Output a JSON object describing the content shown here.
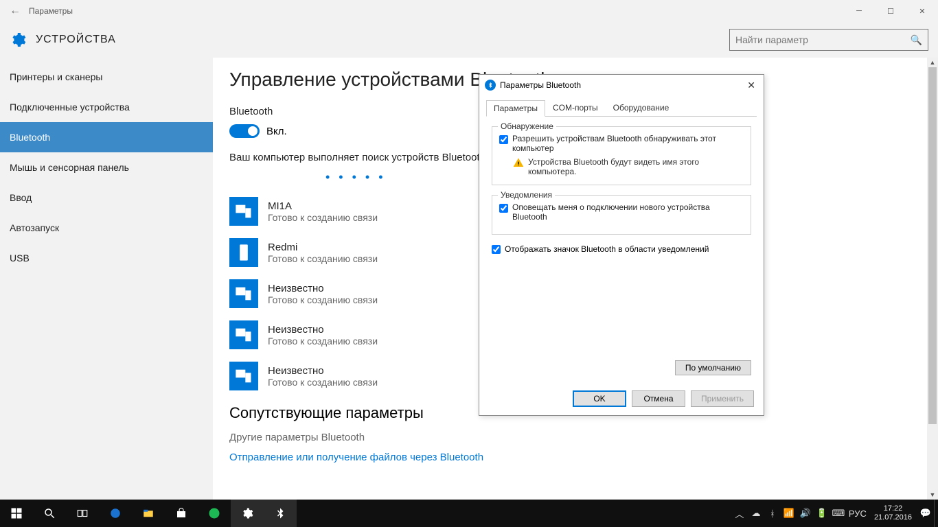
{
  "titlebar": {
    "title": "Параметры"
  },
  "header": {
    "title": "УСТРОЙСТВА",
    "search_placeholder": "Найти параметр"
  },
  "sidebar": {
    "items": [
      {
        "label": "Принтеры и сканеры",
        "active": false
      },
      {
        "label": "Подключенные устройства",
        "active": false
      },
      {
        "label": "Bluetooth",
        "active": true
      },
      {
        "label": "Мышь и сенсорная панель",
        "active": false
      },
      {
        "label": "Ввод",
        "active": false
      },
      {
        "label": "Автозапуск",
        "active": false
      },
      {
        "label": "USB",
        "active": false
      }
    ]
  },
  "main": {
    "heading": "Управление устройствами Bluetooth",
    "toggle_label": "Bluetooth",
    "toggle_state": "Вкл.",
    "description": "Ваш компьютер выполняет поиск устройств Bluetooth и может быть обнаружен ими.",
    "devices": [
      {
        "name": "MI1A",
        "status": "Готово к созданию связи",
        "icon": "multi"
      },
      {
        "name": "Redmi",
        "status": "Готово к созданию связи",
        "icon": "phone"
      },
      {
        "name": "Неизвестно",
        "status": "Готово к созданию связи",
        "icon": "multi"
      },
      {
        "name": "Неизвестно",
        "status": "Готово к созданию связи",
        "icon": "multi"
      },
      {
        "name": "Неизвестно",
        "status": "Готово к созданию связи",
        "icon": "multi"
      }
    ],
    "related_heading": "Сопутствующие параметры",
    "related_link1": "Другие параметры Bluetooth",
    "related_link2": "Отправление или получение файлов через Bluetooth"
  },
  "dialog": {
    "title": "Параметры Bluetooth",
    "tabs": [
      "Параметры",
      "COM-порты",
      "Оборудование"
    ],
    "group1_label": "Обнаружение",
    "chk1": "Разрешить устройствам Bluetooth обнаруживать этот компьютер",
    "warn": "Устройства Bluetooth будут видеть имя этого компьютера.",
    "group2_label": "Уведомления",
    "chk2": "Оповещать меня о подключении нового устройства Bluetooth",
    "chk3": "Отображать значок Bluetooth в области уведомлений",
    "btn_defaults": "По умолчанию",
    "btn_ok": "OK",
    "btn_cancel": "Отмена",
    "btn_apply": "Применить"
  },
  "taskbar": {
    "lang": "РУС",
    "time": "17:22",
    "date": "21.07.2016"
  }
}
